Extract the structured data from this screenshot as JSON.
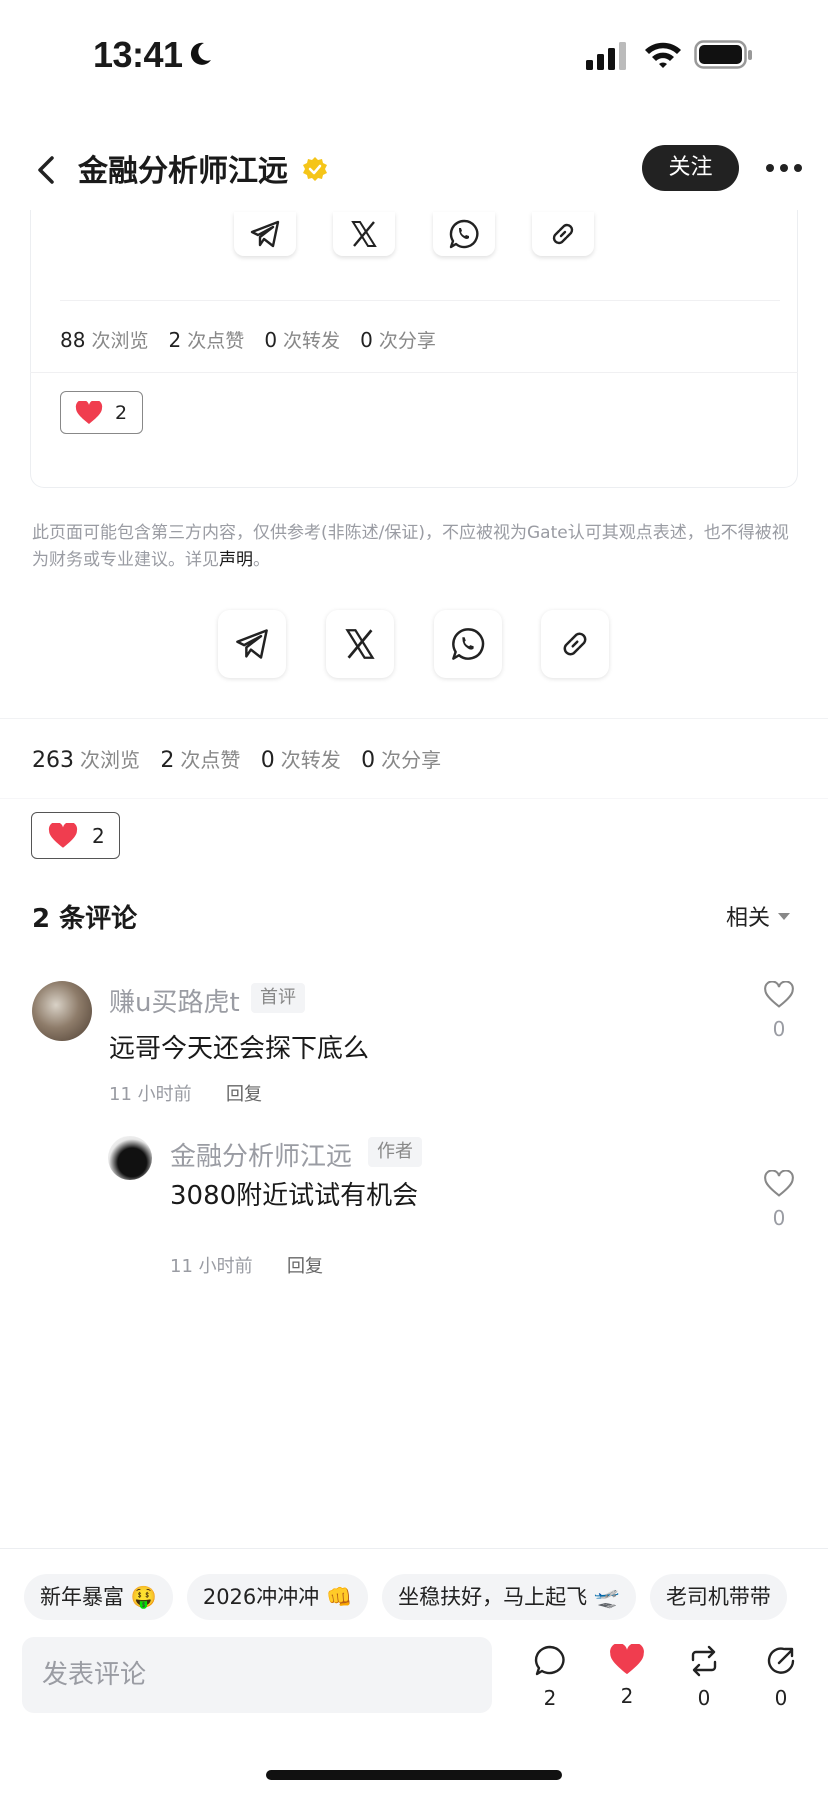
{
  "status_bar": {
    "time": "13:41"
  },
  "header": {
    "author_name": "金融分析师江远",
    "follow_label": "关注"
  },
  "embedded_card": {
    "stats": [
      {
        "value": "88",
        "label": "次浏览"
      },
      {
        "value": "2",
        "label": "次点赞"
      },
      {
        "value": "0",
        "label": "次转发"
      },
      {
        "value": "0",
        "label": "次分享"
      }
    ],
    "like_count": "2"
  },
  "disclaimer": {
    "text": "此页面可能包含第三方内容，仅供参考(非陈述/保证)，不应被视为Gate认可其观点表述，也不得被视为财务或专业建议。详见",
    "link": "声明",
    "end": "。"
  },
  "post_stats": [
    {
      "value": "263",
      "label": "次浏览"
    },
    {
      "value": "2",
      "label": "次点赞"
    },
    {
      "value": "0",
      "label": "次转发"
    },
    {
      "value": "0",
      "label": "次分享"
    }
  ],
  "post_like_count": "2",
  "comments_section": {
    "count_label": "2 条评论",
    "sort_label": "相关"
  },
  "comments": [
    {
      "user": "赚u买路虎t",
      "tag": "首评",
      "text": "远哥今天还会探下底么",
      "time": "11 小时前",
      "reply_label": "回复",
      "likes": "0"
    },
    {
      "user": "金融分析师江远",
      "tag": "作者",
      "text": "3080附近试试有机会",
      "time": "11 小时前",
      "reply_label": "回复",
      "likes": "0"
    }
  ],
  "quick_replies": [
    "新年暴富 🤑",
    "2026冲冲冲 👊",
    "坐稳扶好，马上起飞 🛫",
    "老司机带带"
  ],
  "comment_input": {
    "placeholder": "发表评论"
  },
  "actions": {
    "comment_count": "2",
    "like_count": "2",
    "repost_count": "0",
    "share_count": "0"
  },
  "colors": {
    "like_red": "#f03d4f",
    "follow_bg": "#222222",
    "verified_gold": "#f5c518"
  }
}
